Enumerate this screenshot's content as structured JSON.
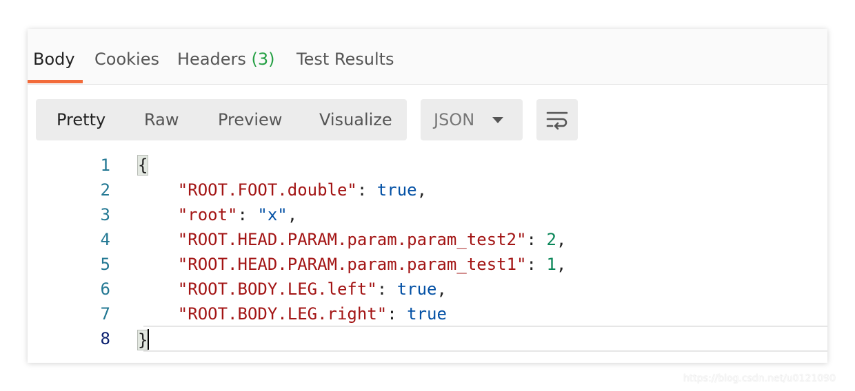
{
  "tabs": [
    {
      "label": "Body",
      "active": true
    },
    {
      "label": "Cookies"
    },
    {
      "label": "Headers",
      "count": "(3)"
    },
    {
      "label": "Test Results"
    }
  ],
  "view_modes": [
    {
      "label": "Pretty",
      "active": true
    },
    {
      "label": "Raw"
    },
    {
      "label": "Preview"
    },
    {
      "label": "Visualize"
    }
  ],
  "format": {
    "selected": "JSON"
  },
  "wrap_button": {
    "icon": "wrap-lines-icon"
  },
  "colors": {
    "accent": "#f26b3a",
    "count": "#26a045",
    "key": "#a31515",
    "value": "#0451a5",
    "number": "#098658"
  },
  "editor": {
    "lines": [
      {
        "num": "1",
        "open": "{"
      },
      {
        "num": "2",
        "key": "\"ROOT.FOOT.double\"",
        "sep": ": ",
        "value": "true",
        "type": "bool",
        "comma": ","
      },
      {
        "num": "3",
        "key": "\"root\"",
        "sep": ": ",
        "value": "\"x\"",
        "type": "str",
        "comma": ","
      },
      {
        "num": "4",
        "key": "\"ROOT.HEAD.PARAM.param.param_test2\"",
        "sep": ": ",
        "value": "2",
        "type": "num",
        "comma": ","
      },
      {
        "num": "5",
        "key": "\"ROOT.HEAD.PARAM.param.param_test1\"",
        "sep": ": ",
        "value": "1",
        "type": "num",
        "comma": ","
      },
      {
        "num": "6",
        "key": "\"ROOT.BODY.LEG.left\"",
        "sep": ": ",
        "value": "true",
        "type": "bool",
        "comma": ","
      },
      {
        "num": "7",
        "key": "\"ROOT.BODY.LEG.right\"",
        "sep": ": ",
        "value": "true",
        "type": "bool",
        "comma": ""
      },
      {
        "num": "8",
        "close": "}"
      }
    ]
  },
  "watermark": "https://blog.csdn.net/u0121090"
}
